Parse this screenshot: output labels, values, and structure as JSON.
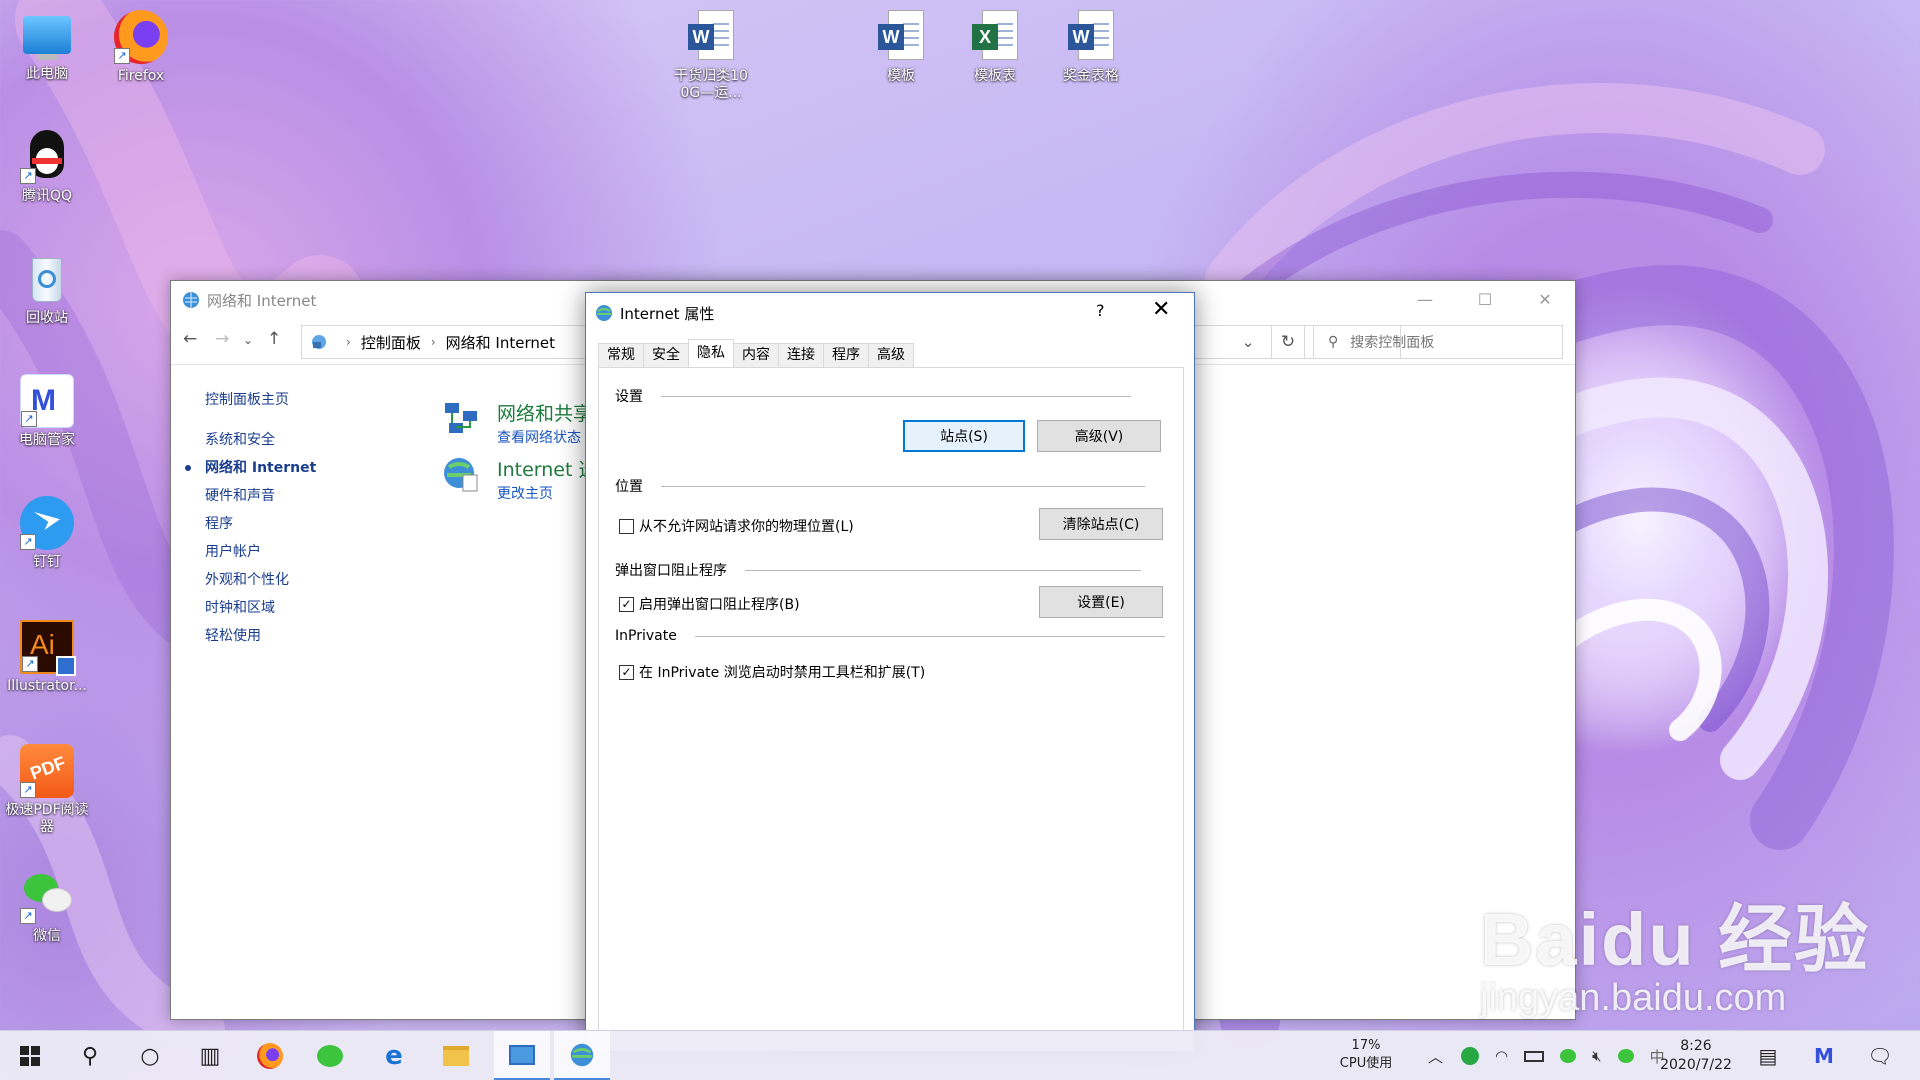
{
  "desktop": {
    "icons": [
      {
        "label": "此电脑"
      },
      {
        "label": "Firefox"
      },
      {
        "label": "腾讯QQ"
      },
      {
        "label": "回收站"
      },
      {
        "label": "电脑管家"
      },
      {
        "label": "钉钉"
      },
      {
        "label": "Illustrator..."
      },
      {
        "label": "极速PDF阅读器"
      },
      {
        "label": "微信"
      },
      {
        "label": "干货归类100G—运...",
        "badge": "W"
      },
      {
        "label": "模板",
        "badge": "W"
      },
      {
        "label": "模板表",
        "badge": "X"
      },
      {
        "label": "奖金表格",
        "badge": "W"
      }
    ]
  },
  "control_panel": {
    "title": "网络和 Internet",
    "breadcrumb": [
      "控制面板",
      "网络和 Internet"
    ],
    "search_placeholder": "搜索控制面板",
    "sidebar": {
      "home": "控制面板主页",
      "items": [
        "系统和安全",
        "网络和 Internet",
        "硬件和声音",
        "程序",
        "用户帐户",
        "外观和个性化",
        "时钟和区域",
        "轻松使用"
      ]
    },
    "categories": [
      {
        "heading": "网络和共享",
        "link": "查看网络状态"
      },
      {
        "heading": "Internet 选",
        "link": "更改主页"
      }
    ]
  },
  "dialog": {
    "title": "Internet 属性",
    "help": "?",
    "close": "✕",
    "tabs": [
      "常规",
      "安全",
      "隐私",
      "内容",
      "连接",
      "程序",
      "高级"
    ],
    "selected_tab": "隐私",
    "settings": {
      "group": "设置",
      "sites_button": "站点(S)",
      "advanced_button": "高级(V)"
    },
    "location": {
      "group": "位置",
      "checkbox_label": "从不允许网站请求你的物理位置(L)",
      "checkbox_checked": false,
      "clear_button": "清除站点(C)"
    },
    "popup": {
      "group": "弹出窗口阻止程序",
      "checkbox_label": "启用弹出窗口阻止程序(B)",
      "checkbox_checked": true,
      "settings_button": "设置(E)"
    },
    "inprivate": {
      "group": "InPrivate",
      "checkbox_label": "在 InPrivate 浏览启动时禁用工具栏和扩展(T)",
      "checkbox_checked": true
    }
  },
  "taskbar": {
    "cpu_percent": "17%",
    "cpu_label": "CPU使用",
    "time": "8:26",
    "date": "2020/7/22",
    "ime": "中"
  },
  "watermark": {
    "line1": "Baidu 经验",
    "line2": "jingyan.baidu.com"
  }
}
